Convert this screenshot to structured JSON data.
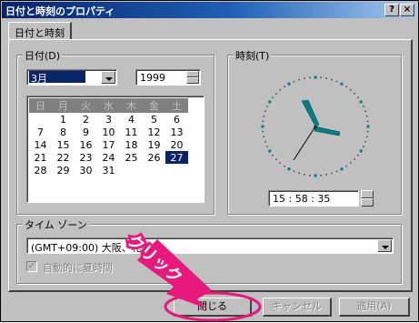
{
  "window": {
    "title": "日付と時刻のプロパティ",
    "help_label": "?",
    "close_label": "×"
  },
  "tab": {
    "label": "日付と時刻"
  },
  "date_group": {
    "legend": "日付(D)",
    "month": "3月",
    "year": "1999",
    "weekdays": [
      "日",
      "月",
      "火",
      "水",
      "木",
      "金",
      "土"
    ],
    "weeks": [
      [
        "",
        "1",
        "2",
        "3",
        "4",
        "5",
        "6"
      ],
      [
        "7",
        "8",
        "9",
        "10",
        "11",
        "12",
        "13"
      ],
      [
        "14",
        "15",
        "16",
        "17",
        "18",
        "19",
        "20"
      ],
      [
        "21",
        "22",
        "23",
        "24",
        "25",
        "26",
        "27"
      ],
      [
        "28",
        "29",
        "30",
        "31",
        "",
        "",
        ""
      ]
    ],
    "selected_day": "27"
  },
  "time_group": {
    "legend": "時刻(T)",
    "time": "15 : 58 : 35"
  },
  "timezone": {
    "legend": "タイム ゾーン",
    "value": "(GMT+09:00) 大阪、札幌",
    "auto_dst_label": "自動的に夏時間",
    "auto_dst_checked": true
  },
  "annotation": {
    "text": "クリック",
    "color": "#e8197d"
  },
  "buttons": {
    "close": "閉じる",
    "cancel": "キャンセル",
    "apply": "適用(A)"
  }
}
